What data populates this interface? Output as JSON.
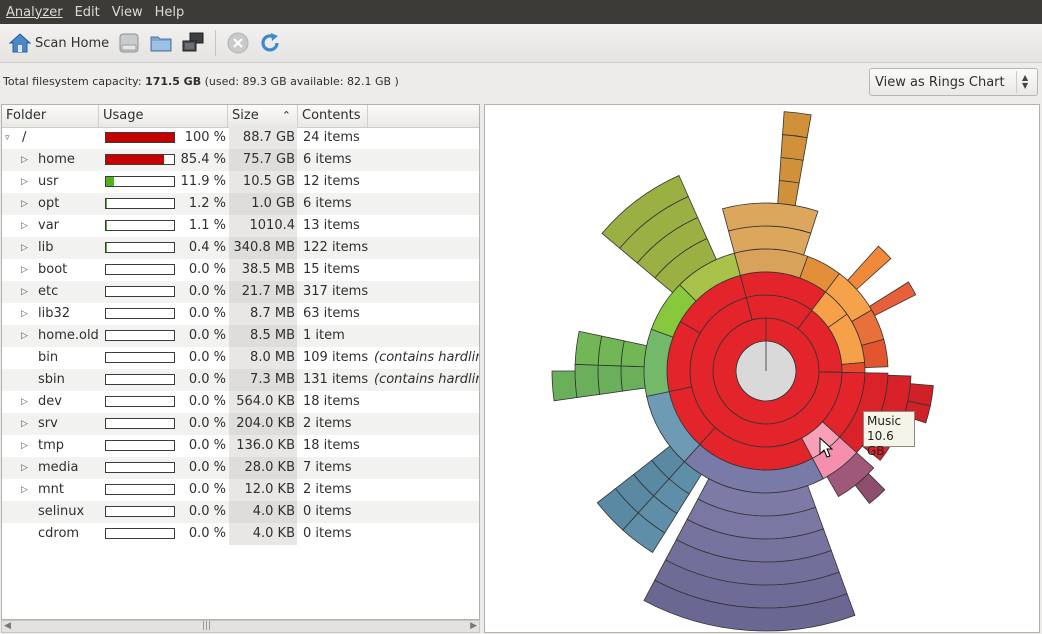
{
  "menu": [
    "Analyzer",
    "Edit",
    "View",
    "Help"
  ],
  "toolbar": {
    "scan_home_label": "Scan Home",
    "icons": [
      "home-icon",
      "disk-icon",
      "folder-icon",
      "network-icon",
      "stop-icon",
      "refresh-icon"
    ]
  },
  "capacity": {
    "label": "Total filesystem capacity:",
    "total": "171.5 GB",
    "detail": "(used: 89.3 GB available: 82.1 GB )"
  },
  "view_select": {
    "value": "View as Rings Chart"
  },
  "columns": {
    "folder": "Folder",
    "usage": "Usage",
    "size": "Size",
    "contents": "Contents"
  },
  "colors": {
    "usage_red": "#c60000",
    "usage_green": "#4fb31b",
    "menubar": "#3c3b37"
  },
  "rows": [
    {
      "name": "/",
      "usage": 1.0,
      "pct": "100 %",
      "size": "88.7 GB",
      "contents": "24 items",
      "note": "",
      "expander": "open",
      "depth": 0
    },
    {
      "name": "home",
      "usage": 0.854,
      "pct": "85.4 %",
      "size": "75.7 GB",
      "contents": "6 items",
      "note": "",
      "expander": "closed",
      "depth": 1
    },
    {
      "name": "usr",
      "usage": 0.119,
      "pct": "11.9 %",
      "size": "10.5 GB",
      "contents": "12 items",
      "note": "",
      "expander": "closed",
      "depth": 1
    },
    {
      "name": "opt",
      "usage": 0.012,
      "pct": "1.2 %",
      "size": "1.0 GB",
      "contents": "6 items",
      "note": "",
      "expander": "closed",
      "depth": 1
    },
    {
      "name": "var",
      "usage": 0.011,
      "pct": "1.1 %",
      "size": "1010.4 MB",
      "contents": "13 items",
      "note": "",
      "expander": "closed",
      "depth": 1
    },
    {
      "name": "lib",
      "usage": 0.004,
      "pct": "0.4 %",
      "size": "340.8 MB",
      "contents": "122 items",
      "note": "",
      "expander": "closed",
      "depth": 1
    },
    {
      "name": "boot",
      "usage": 0.0,
      "pct": "0.0 %",
      "size": "38.5 MB",
      "contents": "15 items",
      "note": "",
      "expander": "closed",
      "depth": 1
    },
    {
      "name": "etc",
      "usage": 0.0,
      "pct": "0.0 %",
      "size": "21.7 MB",
      "contents": "317 items",
      "note": "",
      "expander": "closed",
      "depth": 1
    },
    {
      "name": "lib32",
      "usage": 0.0,
      "pct": "0.0 %",
      "size": "8.7 MB",
      "contents": "63 items",
      "note": "",
      "expander": "closed",
      "depth": 1
    },
    {
      "name": "home.old",
      "usage": 0.0,
      "pct": "0.0 %",
      "size": "8.5 MB",
      "contents": "1 item",
      "note": "",
      "expander": "closed",
      "depth": 1
    },
    {
      "name": "bin",
      "usage": 0.0,
      "pct": "0.0 %",
      "size": "8.0 MB",
      "contents": "109 items",
      "note": "(contains hardlinks",
      "expander": "none",
      "depth": 1
    },
    {
      "name": "sbin",
      "usage": 0.0,
      "pct": "0.0 %",
      "size": "7.3 MB",
      "contents": "131 items",
      "note": "(contains hardlinks",
      "expander": "none",
      "depth": 1
    },
    {
      "name": "dev",
      "usage": 0.0,
      "pct": "0.0 %",
      "size": "564.0 KB",
      "contents": "18 items",
      "note": "",
      "expander": "closed",
      "depth": 1
    },
    {
      "name": "srv",
      "usage": 0.0,
      "pct": "0.0 %",
      "size": "204.0 KB",
      "contents": "2 items",
      "note": "",
      "expander": "closed",
      "depth": 1
    },
    {
      "name": "tmp",
      "usage": 0.0,
      "pct": "0.0 %",
      "size": "136.0 KB",
      "contents": "18 items",
      "note": "",
      "expander": "closed",
      "depth": 1
    },
    {
      "name": "media",
      "usage": 0.0,
      "pct": "0.0 %",
      "size": "28.0 KB",
      "contents": "7 items",
      "note": "",
      "expander": "closed",
      "depth": 1
    },
    {
      "name": "mnt",
      "usage": 0.0,
      "pct": "0.0 %",
      "size": "12.0 KB",
      "contents": "2 items",
      "note": "",
      "expander": "closed",
      "depth": 1
    },
    {
      "name": "selinux",
      "usage": 0.0,
      "pct": "0.0 %",
      "size": "4.0 KB",
      "contents": "0 items",
      "note": "",
      "expander": "none",
      "depth": 1
    },
    {
      "name": "cdrom",
      "usage": 0.0,
      "pct": "0.0 %",
      "size": "4.0 KB",
      "contents": "0 items",
      "note": "",
      "expander": "none",
      "depth": 1
    }
  ],
  "tooltip": {
    "name": "Music",
    "size": "10.6 GB"
  }
}
